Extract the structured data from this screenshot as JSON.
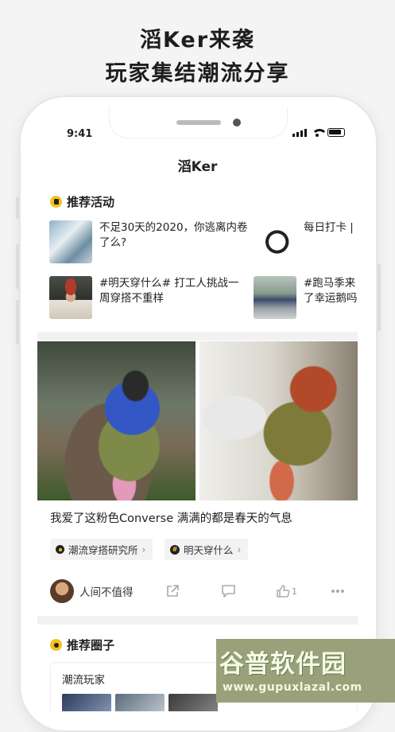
{
  "promo": {
    "line1": "滔Ker来袭",
    "line2": "玩家集结潮流分享"
  },
  "status_bar": {
    "time": "9:41"
  },
  "app": {
    "title": "滔Ker"
  },
  "recommended_activities": {
    "title": "推荐活动",
    "items": [
      {
        "text": "不足30天的2020，你逃离内卷了么?"
      },
      {
        "text": "每日打卡 |"
      },
      {
        "text": "#明天穿什么# 打工人挑战一周穿搭不重样"
      },
      {
        "text": "#跑马季来了幸运鹅吗?"
      }
    ]
  },
  "post": {
    "caption": "我爱了这粉色Converse 满满的都是春天的气息",
    "tags": [
      {
        "label": "潮流穿搭研究所"
      },
      {
        "label": "明天穿什么"
      }
    ],
    "author": "人间不值得",
    "like_count": "1"
  },
  "recommended_circles": {
    "title": "推荐圈子",
    "circle_name": "潮流玩家",
    "arrow": "→"
  },
  "watermark": {
    "big": "谷普软件园",
    "url": "www.gupuxlazal.com"
  },
  "colors": {
    "accent": "#f5c21b",
    "text": "#222222",
    "background": "#f4f4f4"
  }
}
